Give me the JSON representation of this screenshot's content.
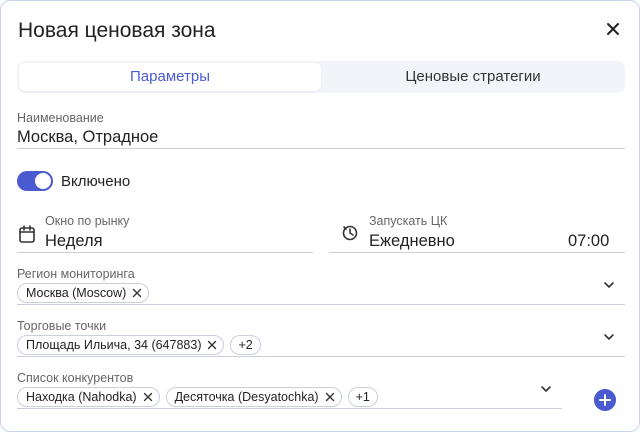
{
  "dialog": {
    "title": "Новая ценовая зона"
  },
  "tabs": [
    {
      "label": "Параметры"
    },
    {
      "label": "Ценовые стратегии"
    }
  ],
  "name_field": {
    "label": "Наименование",
    "value": "Москва, Отрадное"
  },
  "enabled_toggle": {
    "label": "Включено",
    "on": true
  },
  "market_window": {
    "label": "Окно по рынку",
    "value": "Неделя",
    "icon": "calendar-icon"
  },
  "run_schedule": {
    "label": "Запускать ЦК",
    "value": "Ежедневно",
    "time": "07:00",
    "icon": "timer-icon"
  },
  "region": {
    "label": "Регион мониторинга",
    "chips": [
      "Москва (Moscow)"
    ]
  },
  "stores": {
    "label": "Торговые точки",
    "chips": [
      "Площадь Ильича, 34 (647883)"
    ],
    "more": "+2"
  },
  "competitors": {
    "label": "Список конкурентов",
    "chips": [
      "Находка (Nahodka)",
      "Десяточка (Desyatochka)"
    ],
    "more": "+1"
  },
  "colors": {
    "accent": "#4a5bd0",
    "border": "#c9cfdf"
  }
}
